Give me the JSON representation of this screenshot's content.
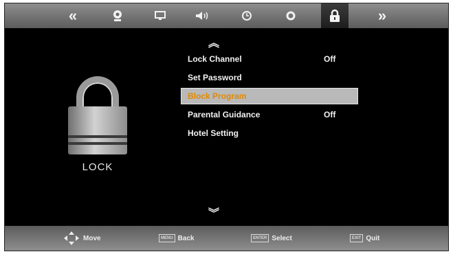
{
  "top_menu": {
    "items": [
      {
        "name": "prev-page-icon",
        "glyph": "«"
      },
      {
        "name": "picture-icon",
        "glyph": ""
      },
      {
        "name": "screen-icon",
        "glyph": ""
      },
      {
        "name": "sound-icon",
        "glyph": ""
      },
      {
        "name": "time-icon",
        "glyph": ""
      },
      {
        "name": "option-icon",
        "glyph": ""
      },
      {
        "name": "lock-icon",
        "glyph": ""
      },
      {
        "name": "next-page-icon",
        "glyph": "»"
      }
    ],
    "active": "lock-icon"
  },
  "lock_panel": {
    "label": "LOCK"
  },
  "menu": {
    "items": [
      {
        "label": "Lock Channel",
        "value": "Off"
      },
      {
        "label": "Set Password",
        "value": ""
      },
      {
        "label": "Block Program",
        "value": ""
      },
      {
        "label": "Parental Guidance",
        "value": "Off"
      },
      {
        "label": "Hotel  Setting",
        "value": ""
      }
    ],
    "selected_index": 2,
    "up_arrow": "︽",
    "down_arrow": "︾"
  },
  "footer": {
    "move": {
      "label": "Move"
    },
    "back": {
      "key": "MENU",
      "label": "Back"
    },
    "select": {
      "key": "ENTER",
      "label": "Select"
    },
    "quit": {
      "key": "EXIT",
      "label": "Quit"
    }
  },
  "colors": {
    "selected_text": "#e28a00",
    "selected_bg": "#b9b9b9",
    "bar_top": "#8e8e8e",
    "bar_bottom": "#5c5c5c"
  }
}
